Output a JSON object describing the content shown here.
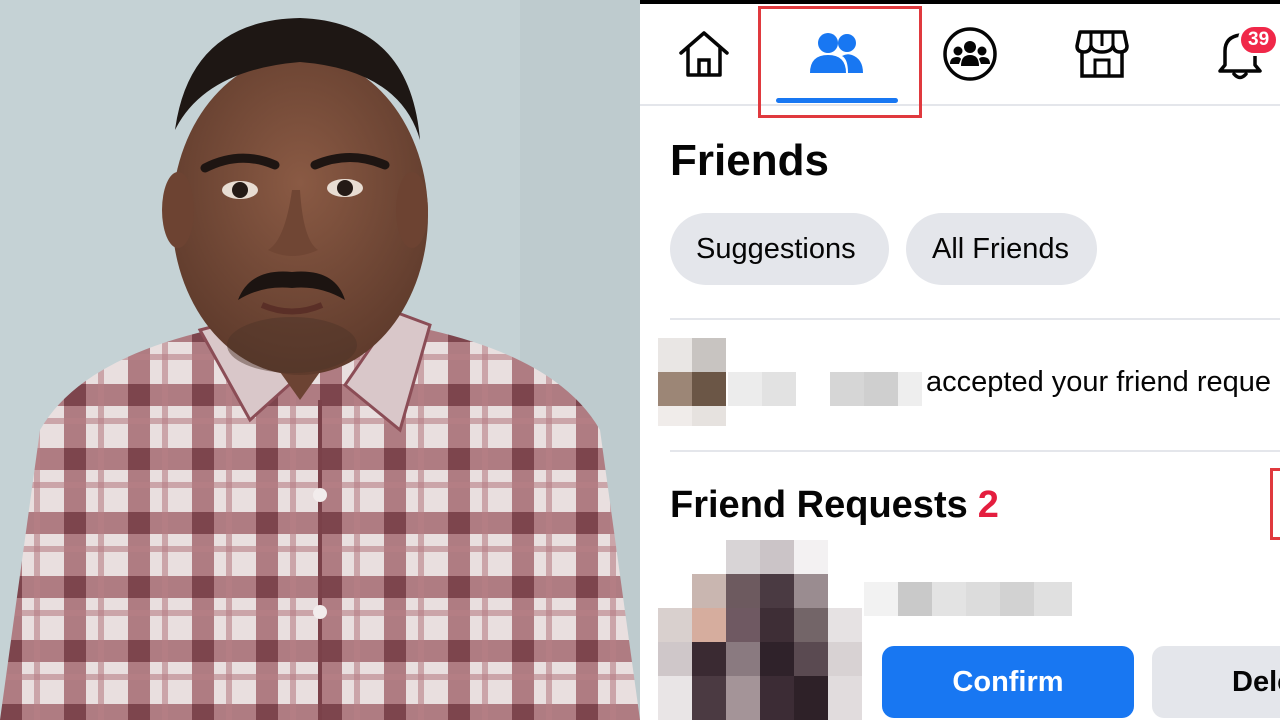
{
  "nav": {
    "items": [
      {
        "id": "home",
        "icon": "home-icon"
      },
      {
        "id": "friends",
        "icon": "friends-icon",
        "active": true
      },
      {
        "id": "groups",
        "icon": "groups-icon"
      },
      {
        "id": "marketplace",
        "icon": "marketplace-icon"
      },
      {
        "id": "notifications",
        "icon": "bell-icon",
        "badge": "39"
      }
    ],
    "active_color": "#1877f2"
  },
  "friends_page": {
    "title": "Friends",
    "filters": [
      "Suggestions",
      "All Friends"
    ],
    "notification": {
      "text": "accepted your friend reque"
    },
    "requests": {
      "title": "Friend Requests",
      "count": "2",
      "confirm_label": "Confirm",
      "delete_label": "Dele"
    }
  },
  "colors": {
    "accent": "#1877f2",
    "badge": "#f02849",
    "count": "#e41e3f",
    "highlight": "#e0393e",
    "pill_bg": "#e4e6eb"
  }
}
